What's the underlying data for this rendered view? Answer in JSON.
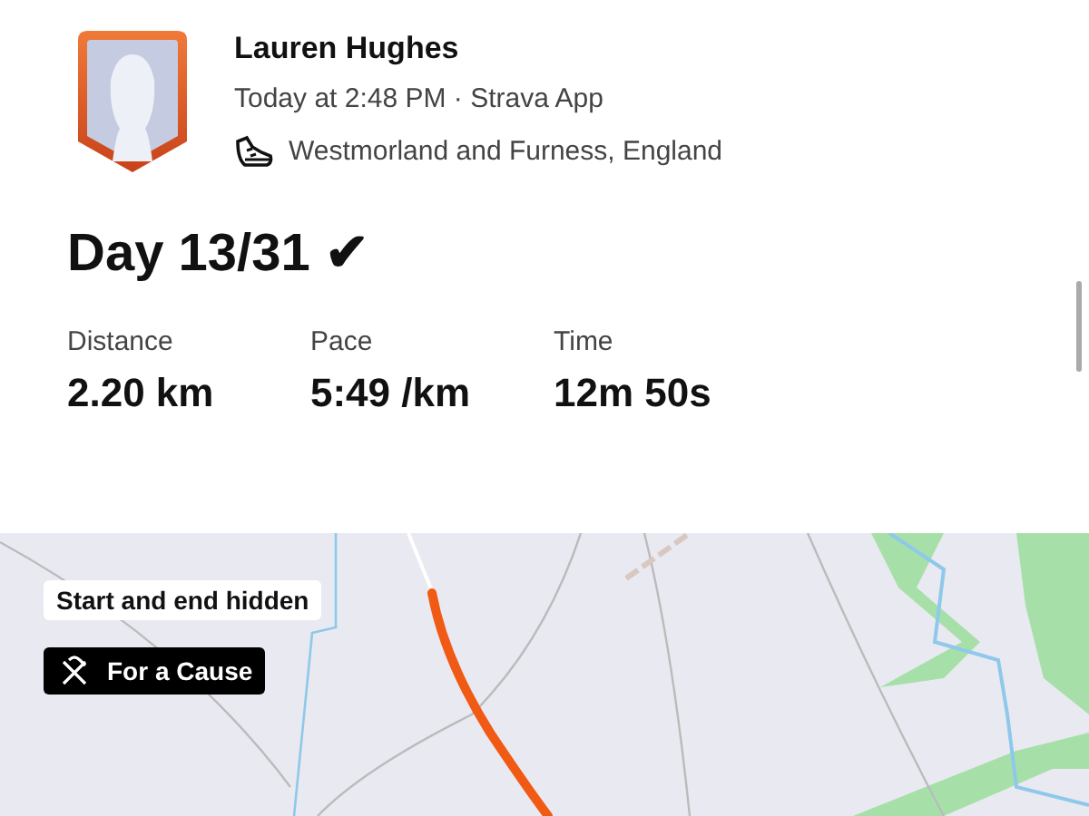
{
  "athlete": {
    "name": "Lauren Hughes",
    "meta": "Today at 2:48 PM · Strava App",
    "location": "Westmorland and Furness, England"
  },
  "activity": {
    "title": "Day 13/31 ✔"
  },
  "stats": [
    {
      "label": "Distance",
      "value": "2.20 km"
    },
    {
      "label": "Pace",
      "value": "5:49 /km"
    },
    {
      "label": "Time",
      "value": "12m 50s"
    }
  ],
  "map": {
    "kind": "picture",
    "privacy_note": "Start and end hidden",
    "tag": "For a Cause"
  }
}
